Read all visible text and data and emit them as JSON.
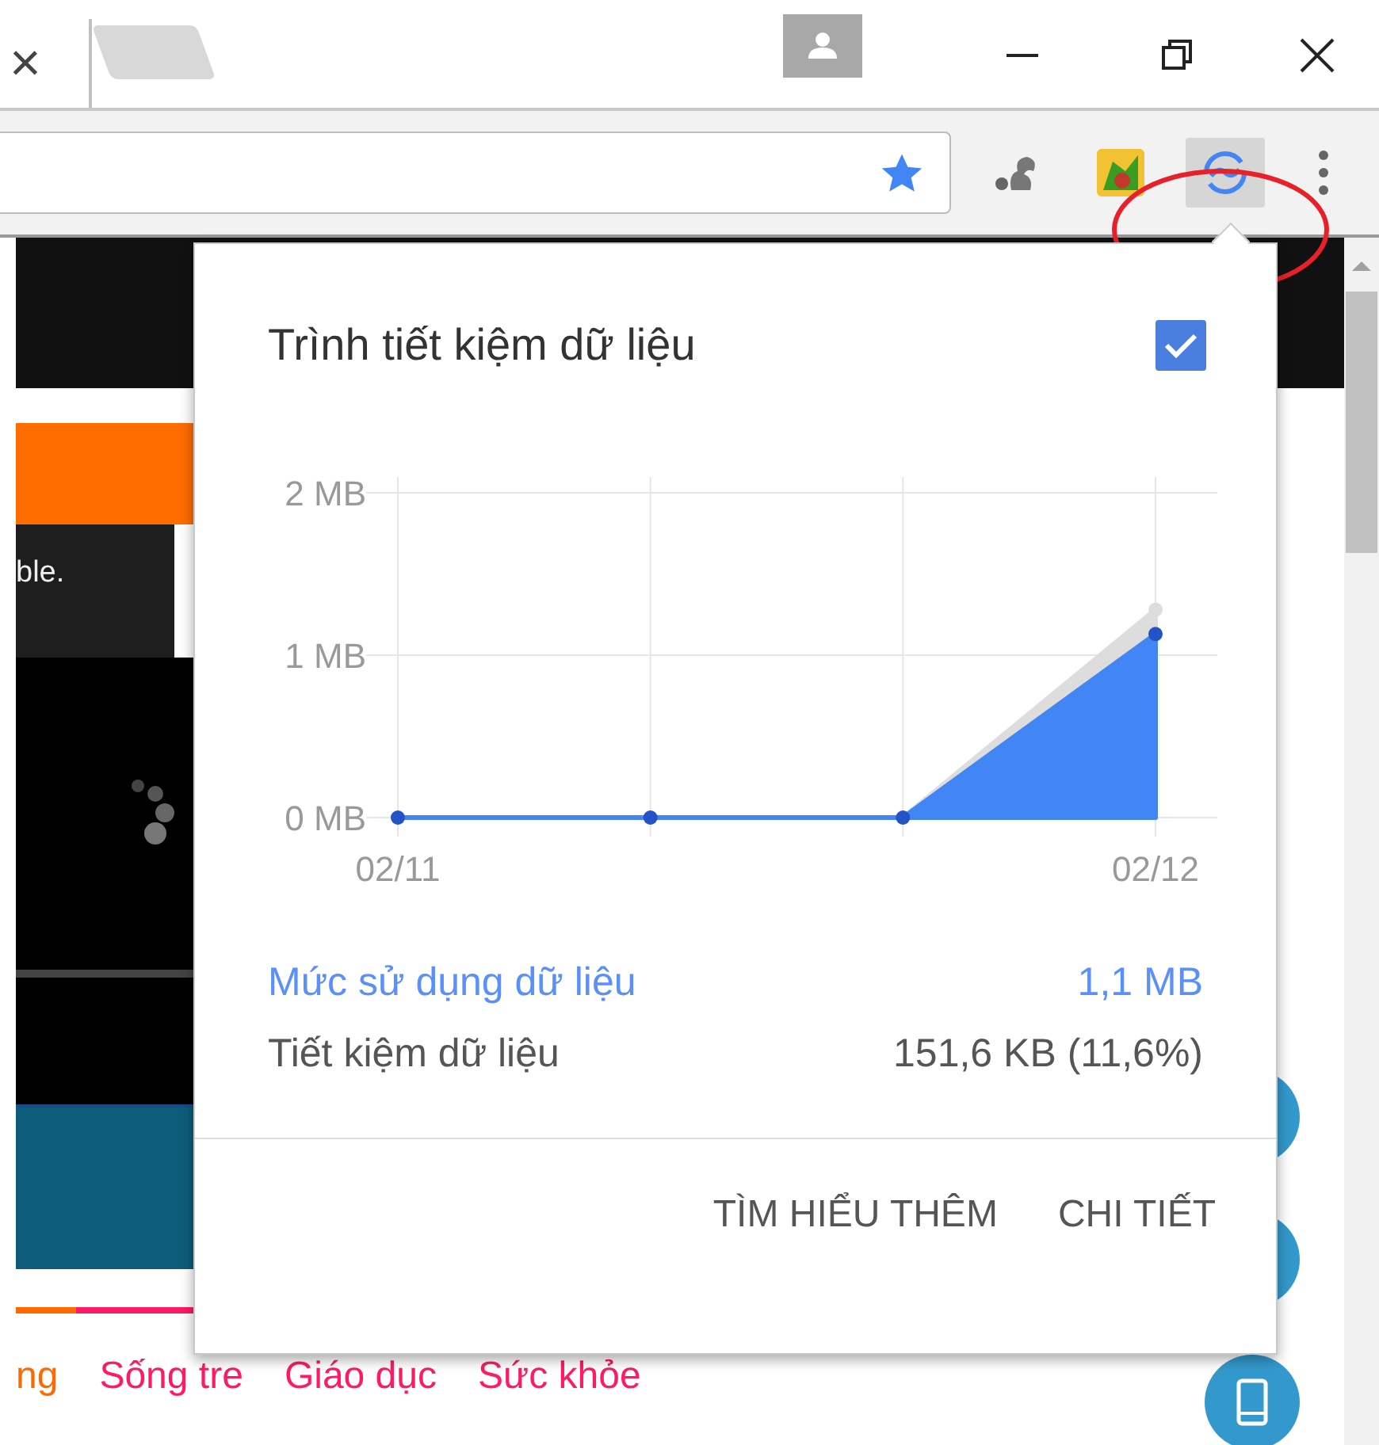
{
  "browser": {
    "tabs": [
      {
        "close_label": "×",
        "selected": true
      },
      {
        "selected": false
      }
    ]
  },
  "page_behind": {
    "snippet": "ble.",
    "categories": [
      {
        "label": "ng",
        "color": "#ff6a00"
      },
      {
        "label": "Sống tre",
        "color": "#ff1a66"
      },
      {
        "label": "Giáo dục",
        "color": "#ff1a66"
      },
      {
        "label": "Sức khỏe",
        "color": "#ff1a66"
      }
    ]
  },
  "popup": {
    "title": "Trình tiết kiệm dữ liệu",
    "enabled": true,
    "chart_data": {
      "type": "area",
      "grid": true,
      "categories": [
        "02/11",
        null,
        null,
        "02/12"
      ],
      "ylim": [
        0,
        2
      ],
      "yticks": [
        {
          "value": 0,
          "label": "0 MB"
        },
        {
          "value": 1,
          "label": "1 MB"
        },
        {
          "value": 2,
          "label": "2 MB"
        }
      ],
      "series": [
        {
          "color": "#dddddd",
          "values": [
            0,
            0,
            0,
            1.28
          ]
        },
        {
          "color": "#4285f4",
          "values": [
            0,
            0,
            0,
            1.13
          ]
        }
      ]
    },
    "stats": [
      {
        "label": "Mức sử dụng dữ liệu",
        "value": "1,1 MB",
        "kind": "highlight"
      },
      {
        "label": "Tiết kiệm dữ liệu",
        "value": "151,6 KB (11,6%)",
        "kind": "plain"
      }
    ],
    "buttons": [
      "TÌM HIỂU THÊM",
      "CHI TIẾT"
    ]
  }
}
